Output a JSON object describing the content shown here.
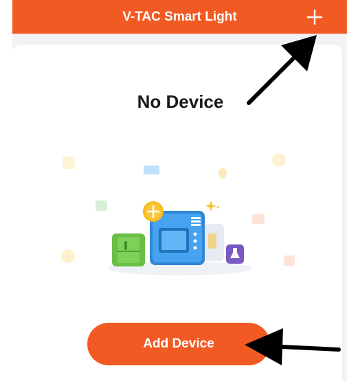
{
  "header": {
    "title": "V-TAC Smart Light",
    "add_icon": "plus-icon"
  },
  "empty_state": {
    "title": "No Device",
    "illustration": "smart-devices-illustration",
    "add_button_label": "Add Device"
  },
  "colors": {
    "accent": "#f25a23",
    "card_bg": "#ffffff",
    "page_bg": "#f2f2f4",
    "title_text": "#1a1a1a"
  }
}
